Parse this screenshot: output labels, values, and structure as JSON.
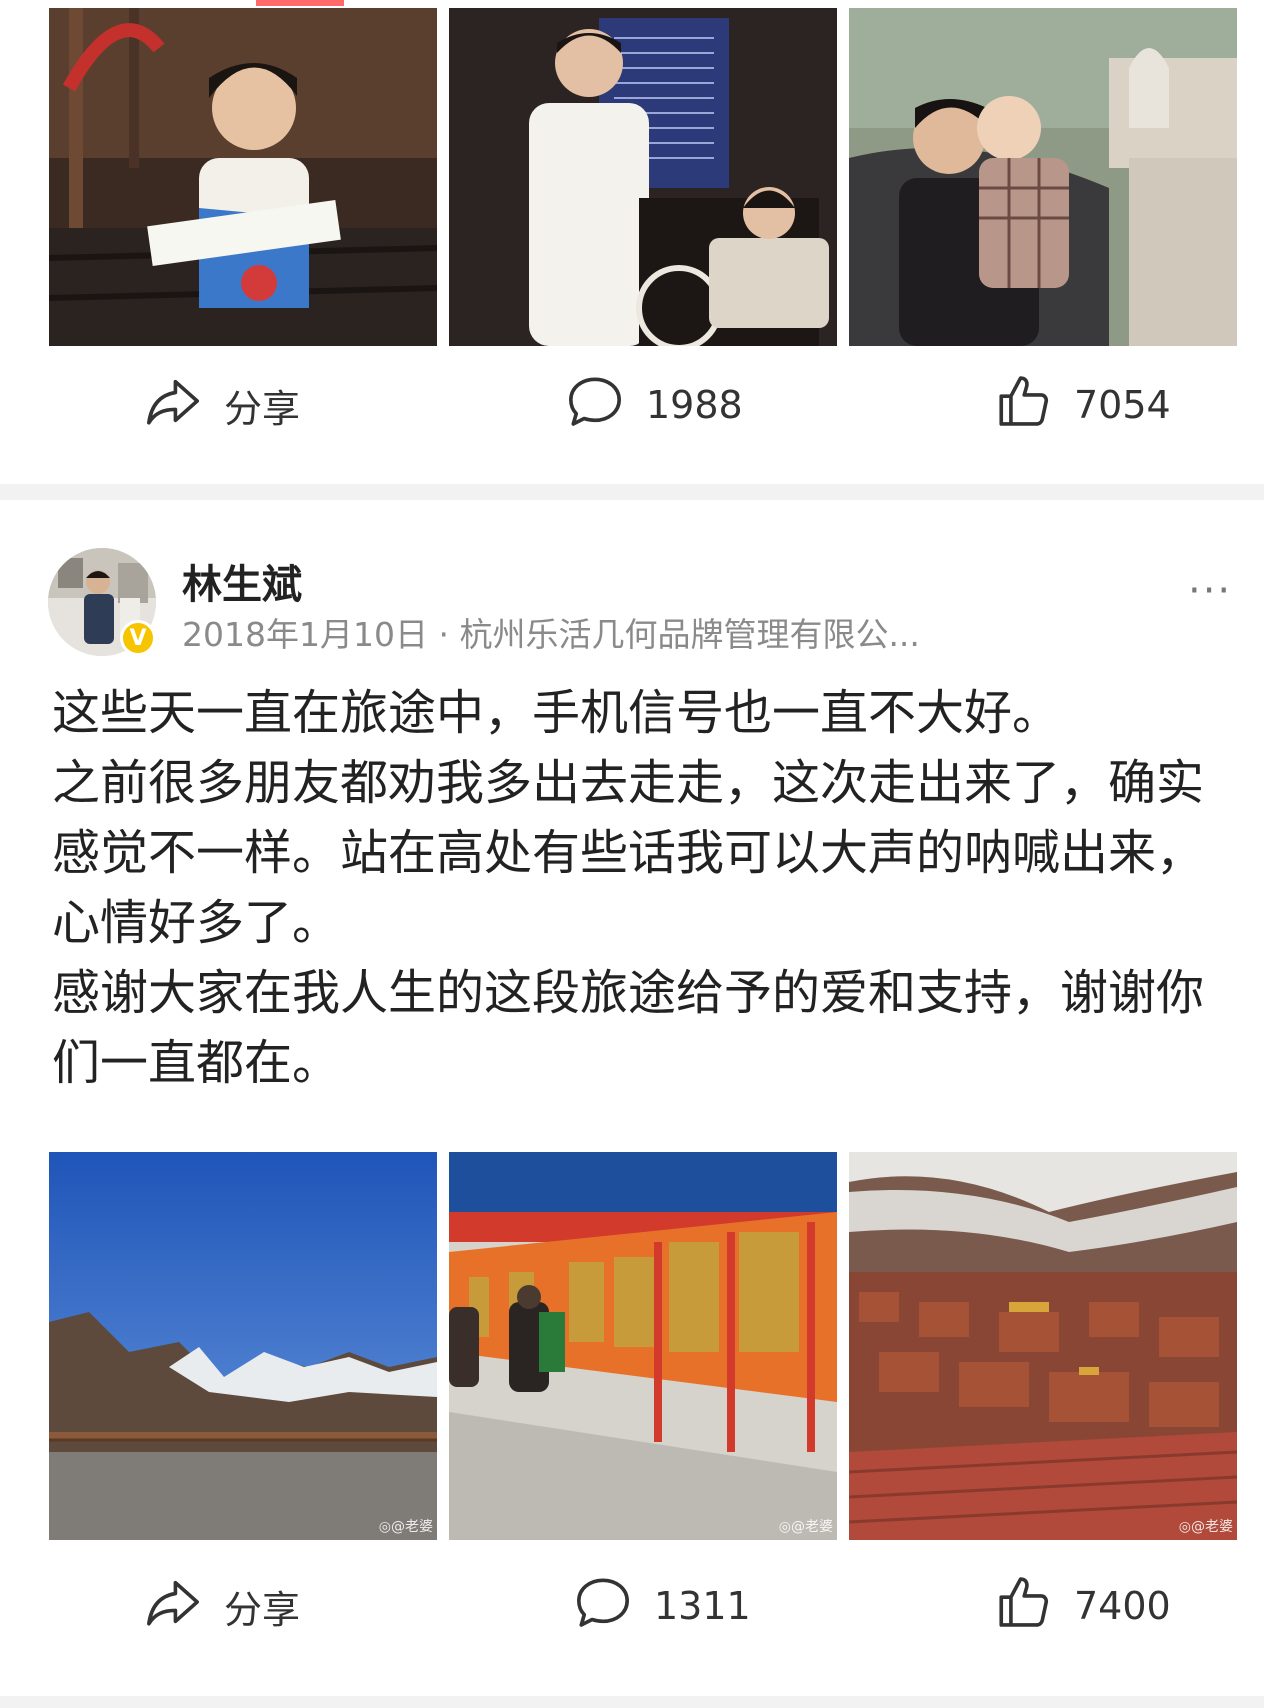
{
  "post1": {
    "images": [
      "child-reading-photo",
      "man-and-child-bicycle-photo",
      "man-kissing-baby-photo"
    ],
    "actions": {
      "share_label": "分享",
      "comments": "1988",
      "likes": "7054"
    }
  },
  "post2": {
    "author": "林生斌",
    "meta": "2018年1月10日 · 杭州乐活几何品牌管理有限公...",
    "verified_badge": "V",
    "more_label": "···",
    "text_lines": [
      "这些天一直在旅途中，手机信号也一直不大好。",
      "之前很多朋友都劝我多出去走走，这次走出来了，确实感觉不一样。站在高处有些话我可以大声的呐喊出来，心情好多了。",
      "感谢大家在我人生的这段旅途给予的爱和支持，谢谢你们一直都在。"
    ],
    "watermark": "◎@老婆",
    "images": [
      "mountain-view-photo",
      "prayer-wheels-photo",
      "red-houses-valley-photo"
    ],
    "actions": {
      "share_label": "分享",
      "comments": "1311",
      "likes": "7400"
    }
  },
  "colors": {
    "accent": "#ff6b6b",
    "verified": "#f7c400",
    "meta": "#8a8a8a",
    "background": "#f2f2f2"
  },
  "icons": [
    "share-icon",
    "comment-icon",
    "like-icon",
    "verified-icon",
    "more-icon"
  ]
}
